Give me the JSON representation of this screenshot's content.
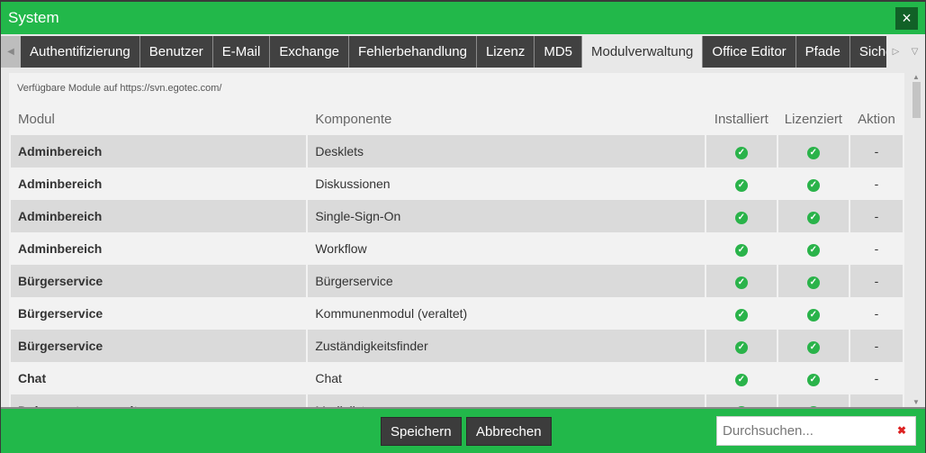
{
  "window": {
    "title": "System",
    "close": "×"
  },
  "tabs": [
    "Authentifizierung",
    "Benutzer",
    "E-Mail",
    "Exchange",
    "Fehlerbehandlung",
    "Lizenz",
    "MD5",
    "Modulverwaltung",
    "Office Editor",
    "Pfade",
    "Sicherh"
  ],
  "active_tab": "Modulverwaltung",
  "hint": "Verfügbare Module auf https://svn.egotec.com/",
  "columns": [
    "Modul",
    "Komponente",
    "Installiert",
    "Lizenziert",
    "Aktion"
  ],
  "rows": [
    {
      "modul": "Adminbereich",
      "komponente": "Desklets",
      "installiert": true,
      "lizenziert": true,
      "aktion": "-"
    },
    {
      "modul": "Adminbereich",
      "komponente": "Diskussionen",
      "installiert": true,
      "lizenziert": true,
      "aktion": "-"
    },
    {
      "modul": "Adminbereich",
      "komponente": "Single-Sign-On",
      "installiert": true,
      "lizenziert": true,
      "aktion": "-"
    },
    {
      "modul": "Adminbereich",
      "komponente": "Workflow",
      "installiert": true,
      "lizenziert": true,
      "aktion": "-"
    },
    {
      "modul": "Bürgerservice",
      "komponente": "Bürgerservice",
      "installiert": true,
      "lizenziert": true,
      "aktion": "-"
    },
    {
      "modul": "Bürgerservice",
      "komponente": "Kommunenmodul (veraltet)",
      "installiert": true,
      "lizenziert": true,
      "aktion": "-"
    },
    {
      "modul": "Bürgerservice",
      "komponente": "Zuständigkeitsfinder",
      "installiert": true,
      "lizenziert": true,
      "aktion": "-"
    },
    {
      "modul": "Chat",
      "komponente": "Chat",
      "installiert": true,
      "lizenziert": true,
      "aktion": "-"
    },
    {
      "modul": "Dokumentenverwaltung",
      "komponente": "Medialist",
      "installiert": true,
      "lizenziert": true,
      "aktion": "-"
    }
  ],
  "footer": {
    "save": "Speichern",
    "cancel": "Abbrechen",
    "search_placeholder": "Durchsuchen...",
    "search_value": ""
  },
  "colors": {
    "accent": "#22b84a",
    "tab_bg": "#414141",
    "check": "#2ab34a"
  }
}
